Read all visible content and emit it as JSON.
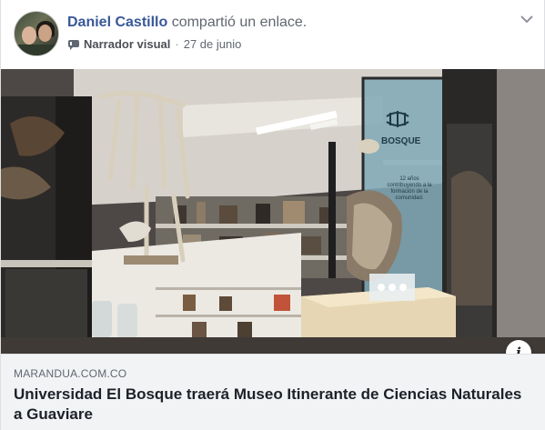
{
  "post": {
    "author": "Daniel Castillo",
    "action": "compartió un enlace.",
    "page_name": "Narrador visual",
    "separator": "·",
    "date": "27 de junio"
  },
  "icons": {
    "menu": "chevron-down-icon",
    "page": "page-flag-icon",
    "info": "info-icon"
  },
  "info_label": "i",
  "link": {
    "domain": "MARANDUA.COM.CO",
    "title": "Universidad El Bosque traerá Museo Itinerante de Ciencias Naturales a Guaviare"
  },
  "photo": {
    "exhibit_sign": "BOSQUE",
    "exhibit_sign_text": "12 años contribuyendo a la formación de la comunidad."
  },
  "colors": {
    "author": "#385898",
    "muted": "#606770",
    "link_bg": "#f2f3f5",
    "border": "#dddfe2"
  }
}
